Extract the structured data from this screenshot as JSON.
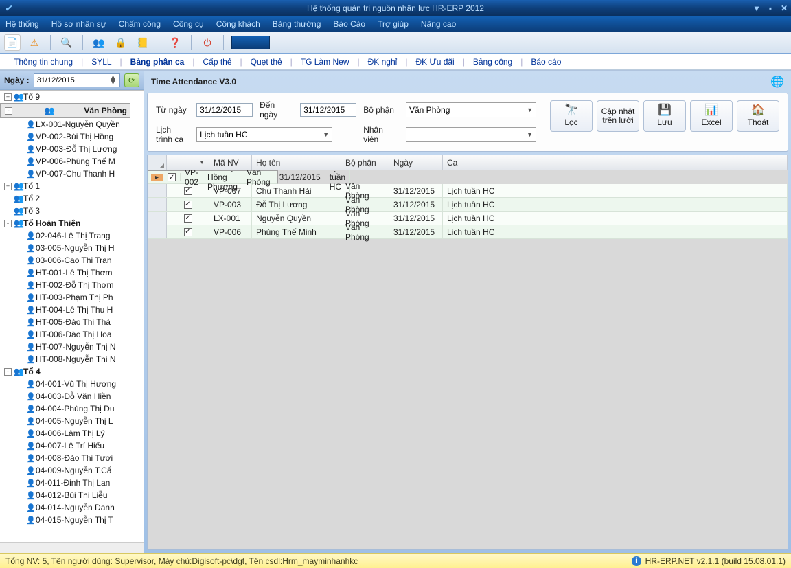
{
  "window": {
    "title": "Hệ thống quản trị nguồn nhân lực HR-ERP 2012"
  },
  "menu": [
    "Hệ thống",
    "Hồ sơ nhân sự",
    "Chấm công",
    "Công cụ",
    "Công khách",
    "Bảng thưởng",
    "Báo Cáo",
    "Trợ giúp",
    "Nâng cao"
  ],
  "tabs": [
    "Thông tin chung",
    "SYLL",
    "Bảng phân ca",
    "Cấp thẻ",
    "Quẹt thẻ",
    "TG Làm New",
    "ĐK nghỉ",
    "ĐK Ưu đãi",
    "Bảng công",
    "Báo cáo"
  ],
  "left": {
    "date_label": "Ngày :",
    "date_value": "31/12/2015",
    "tree": [
      {
        "l": 0,
        "exp": "+",
        "type": "g",
        "label": "Tổ 9"
      },
      {
        "l": 0,
        "exp": "-",
        "type": "g",
        "label": "Văn Phòng",
        "bold": true,
        "sel": true
      },
      {
        "l": 1,
        "type": "p",
        "label": "LX-001-Nguyễn Quyền"
      },
      {
        "l": 1,
        "type": "p",
        "label": "VP-002-Bùi Thị Hồng"
      },
      {
        "l": 1,
        "type": "p",
        "label": "VP-003-Đỗ Thị Lương"
      },
      {
        "l": 1,
        "type": "p",
        "label": "VP-006-Phùng Thế M"
      },
      {
        "l": 1,
        "type": "p",
        "label": "VP-007-Chu Thanh H"
      },
      {
        "l": 0,
        "exp": "+",
        "type": "g",
        "label": "Tổ 1"
      },
      {
        "l": 0,
        "exp": "",
        "type": "g",
        "label": "Tổ 2"
      },
      {
        "l": 0,
        "exp": "",
        "type": "g",
        "label": "Tổ 3"
      },
      {
        "l": 0,
        "exp": "-",
        "type": "g",
        "label": "Tổ Hoàn Thiện",
        "bold": true
      },
      {
        "l": 1,
        "type": "p",
        "label": "02-046-Lê Thị Trang"
      },
      {
        "l": 1,
        "type": "p",
        "label": "03-005-Nguyễn Thị H"
      },
      {
        "l": 1,
        "type": "p",
        "label": "03-006-Cao Thị Tran"
      },
      {
        "l": 1,
        "type": "p",
        "label": "HT-001-Lê Thị Thơm"
      },
      {
        "l": 1,
        "type": "p",
        "label": "HT-002-Đỗ Thị Thơm"
      },
      {
        "l": 1,
        "type": "p",
        "label": "HT-003-Phạm Thị Ph"
      },
      {
        "l": 1,
        "type": "p",
        "label": "HT-004-Lê Thị Thu H"
      },
      {
        "l": 1,
        "type": "p",
        "label": "HT-005-Đào Thị Thả"
      },
      {
        "l": 1,
        "type": "p",
        "label": "HT-006-Đào Thị Hoa"
      },
      {
        "l": 1,
        "type": "p",
        "label": "HT-007-Nguyễn Thị N"
      },
      {
        "l": 1,
        "type": "p",
        "label": "HT-008-Nguyễn Thị N"
      },
      {
        "l": 0,
        "exp": "-",
        "type": "g",
        "label": "Tổ 4",
        "bold": true
      },
      {
        "l": 1,
        "type": "p",
        "label": "04-001-Vũ Thị Hương"
      },
      {
        "l": 1,
        "type": "p",
        "label": "04-003-Đỗ Văn Hiền"
      },
      {
        "l": 1,
        "type": "p",
        "label": "04-004-Phùng Thị Du"
      },
      {
        "l": 1,
        "type": "p",
        "label": "04-005-Nguyễn Thị L"
      },
      {
        "l": 1,
        "type": "p",
        "label": "04-006-Lâm Thị Lý"
      },
      {
        "l": 1,
        "type": "p",
        "label": "04-007-Lê Trí Hiếu"
      },
      {
        "l": 1,
        "type": "p",
        "label": "04-008-Đào Thị Tươi"
      },
      {
        "l": 1,
        "type": "p",
        "label": "04-009-Nguyễn T.Cẩ"
      },
      {
        "l": 1,
        "type": "p",
        "label": "04-011-Đinh Thị Lan"
      },
      {
        "l": 1,
        "type": "p",
        "label": "04-012-Bùi Thị Liễu"
      },
      {
        "l": 1,
        "type": "p",
        "label": "04-014-Nguyễn Danh"
      },
      {
        "l": 1,
        "type": "p",
        "label": "04-015-Nguyễn Thị T"
      }
    ]
  },
  "right": {
    "title": "Time Attendance V3.0",
    "filters": {
      "from_label": "Từ ngày",
      "from_value": "31/12/2015",
      "to_label": "Đến ngày",
      "to_value": "31/12/2015",
      "dept_label": "Bộ phận",
      "dept_value": "Văn Phòng",
      "schedule_label": "Lịch trình ca",
      "schedule_value": "Lịch tuần HC",
      "emp_label": "Nhân viên",
      "emp_value": ""
    },
    "buttons": {
      "filter": "Lọc",
      "update1": "Cập nhật",
      "update2": "trên lưới",
      "save": "Lưu",
      "excel": "Excel",
      "exit": "Thoát"
    },
    "columns": [
      "",
      "",
      "Mã NV",
      "Họ tên",
      "Bộ phận",
      "Ngày",
      "Ca"
    ],
    "rows": [
      {
        "sel": true,
        "chk": true,
        "code": "VP-002",
        "name": "Bùi Thị Hồng Phượng",
        "dept": "Văn Phòng",
        "date": "31/12/2015",
        "shift": "Lịch tuần HC"
      },
      {
        "chk": true,
        "code": "VP-007",
        "name": "Chu Thanh Hải",
        "dept": "Văn Phòng",
        "date": "31/12/2015",
        "shift": "Lịch tuần HC"
      },
      {
        "chk": true,
        "code": "VP-003",
        "name": "Đỗ Thị Lương",
        "dept": "Văn Phòng",
        "date": "31/12/2015",
        "shift": "Lịch tuần HC"
      },
      {
        "chk": true,
        "code": "LX-001",
        "name": "Nguyễn Quyền",
        "dept": "Văn Phòng",
        "date": "31/12/2015",
        "shift": "Lịch tuần HC"
      },
      {
        "chk": true,
        "code": "VP-006",
        "name": "Phùng Thế Minh",
        "dept": "Văn Phòng",
        "date": "31/12/2015",
        "shift": "Lịch tuần HC"
      }
    ]
  },
  "status": {
    "left": "Tổng NV: 5, Tên người dùng: Supervisor, Máy chủ:Digisoft-pc\\dgt, Tên csdl:Hrm_mayminhanhkc",
    "right": "HR-ERP.NET v2.1.1 (build 15.08.01.1)"
  }
}
